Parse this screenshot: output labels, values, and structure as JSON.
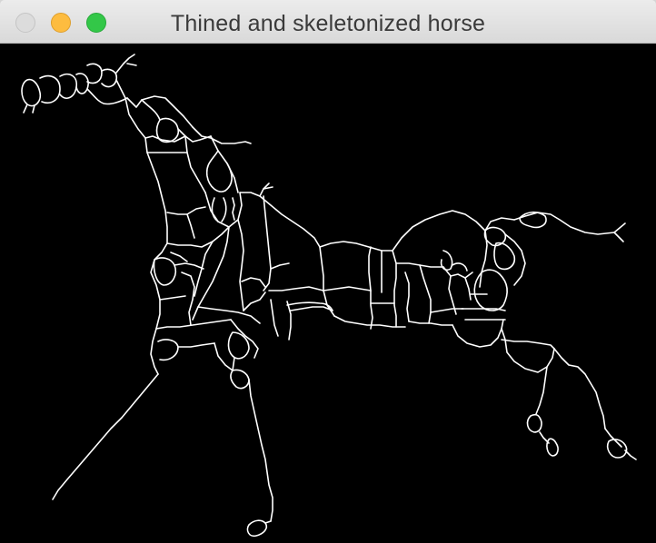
{
  "window": {
    "title": "Thined and skeletonized horse"
  },
  "colors": {
    "titlebar": "#e3e3e3",
    "canvas_background": "#000000",
    "skeleton_stroke": "#ffffff",
    "close": "#dcdcdc",
    "minimize": "#fdbc40",
    "zoom": "#33c748"
  },
  "canvas": {
    "content": "skeletonized-horse-image"
  }
}
